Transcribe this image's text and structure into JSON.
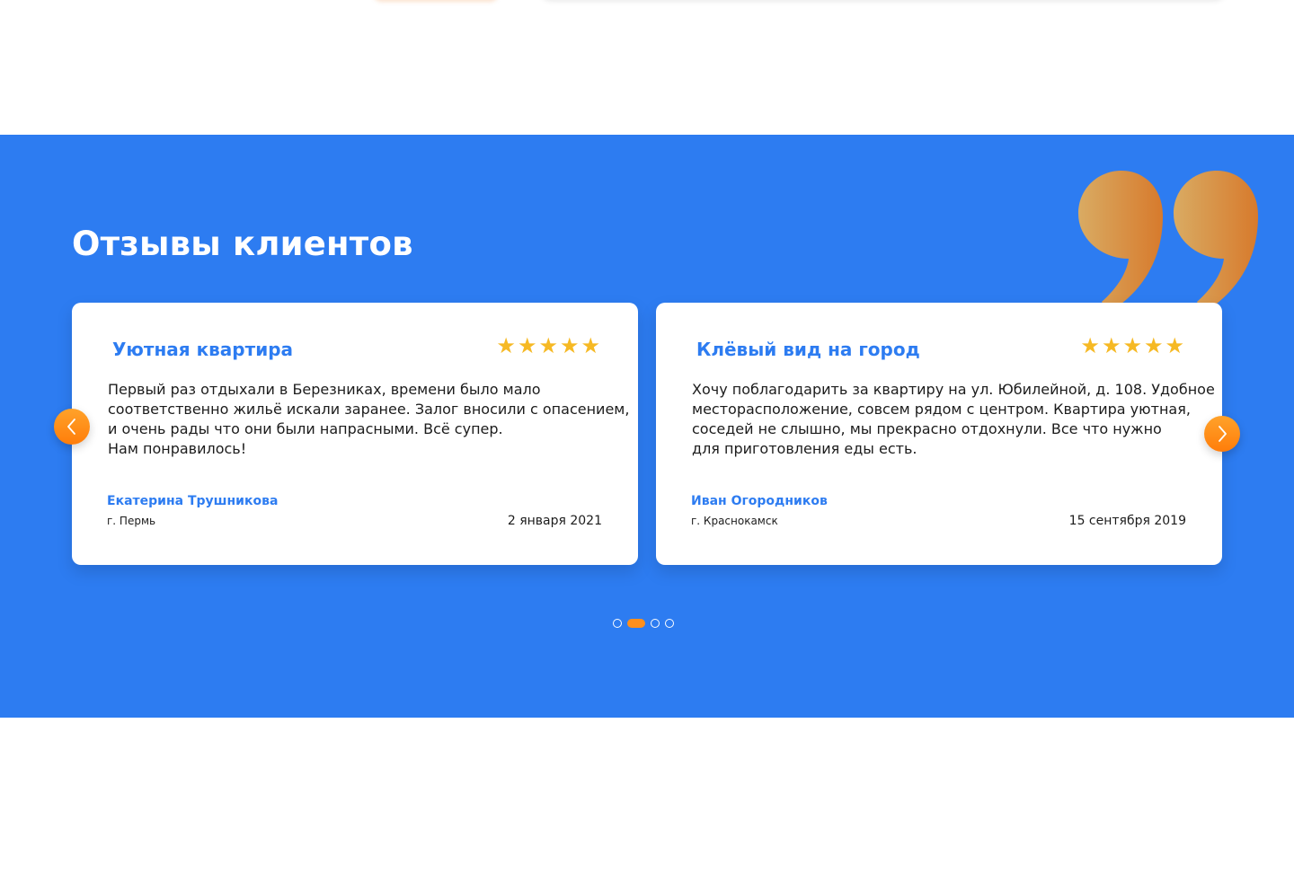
{
  "section": {
    "title": "Отзывы клиентов"
  },
  "reviews": [
    {
      "title": "Уютная квартира",
      "stars": "★★★★★",
      "rating": 5,
      "text_lines": [
        "Первый раз отдыхали в Березниках, времени было мало",
        "соответственно жильё искали заранее. Залог вносили с опасением,",
        "и очень рады что они были напрасными. Всё супер.",
        "Нам понравилось!"
      ],
      "author": "Екатерина Трушникова",
      "city": "г. Пермь",
      "date": "2 января 2021"
    },
    {
      "title": "Клёвый вид на город",
      "stars": "★★★★★",
      "rating": 5,
      "text_lines": [
        "Хочу поблагодарить за квартиру на ул. Юбилейной, д. 108. Удобное",
        "месторасположение, совсем рядом с центром. Квартира уютная,",
        "соседей не слышно, мы прекрасно отдохнули. Все что нужно",
        "для приготовления еды есть."
      ],
      "author": "Иван Огородников",
      "city": "г. Краснокамск",
      "date": "15 сентября 2019"
    }
  ],
  "navigation": {
    "prev_icon": "chevron-left-icon",
    "next_icon": "chevron-right-icon"
  },
  "pagination": {
    "total": 4,
    "active_index": 1
  },
  "colors": {
    "section_background": "#2d7cf1",
    "accent": "#ff8f1c",
    "star": "#f6b924",
    "title_blue": "#2d7cf1"
  }
}
